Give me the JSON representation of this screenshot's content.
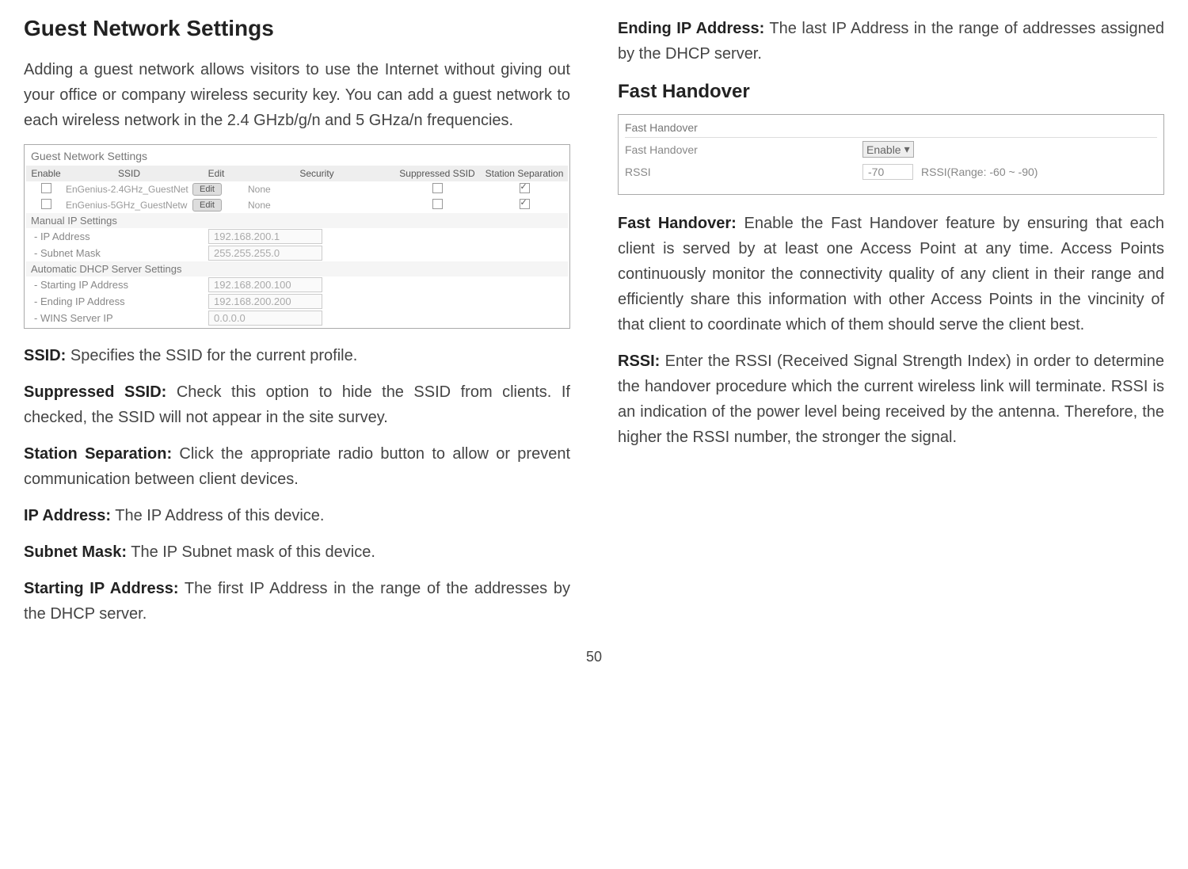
{
  "left": {
    "h2": "Guest Network Settings",
    "intro": "Adding a guest network allows visitors to use the Internet without giving out your office or company wireless security key. You can add a guest network to each wireless network in the  2.4 GHzb/g/n and 5 GHza/n frequencies.",
    "table": {
      "title": "Guest Network Settings",
      "headers": {
        "enable": "Enable",
        "ssid": "SSID",
        "edit": "Edit",
        "security": "Security",
        "suppressed": "Suppressed SSID",
        "station": "Station Separation"
      },
      "rows": [
        {
          "ssid": "EnGenius-2.4GHz_GuestNet",
          "edit": "Edit",
          "security": "None"
        },
        {
          "ssid": "EnGenius-5GHz_GuestNetw",
          "edit": "Edit",
          "security": "None"
        }
      ],
      "manual_label": "Manual IP Settings",
      "ip_address": {
        "lbl": "- IP Address",
        "val": "192.168.200.1"
      },
      "subnet": {
        "lbl": "- Subnet Mask",
        "val": "255.255.255.0"
      },
      "dhcp_label": "Automatic DHCP Server Settings",
      "start_ip": {
        "lbl": "- Starting IP Address",
        "val": "192.168.200.100"
      },
      "end_ip": {
        "lbl": "- Ending IP Address",
        "val": "192.168.200.200"
      },
      "wins": {
        "lbl": "- WINS Server IP",
        "val": "0.0.0.0"
      }
    },
    "ssid_label": "SSID:",
    "ssid_text": " Specifies the SSID for the current profile.",
    "supp_label": "Suppressed SSID:",
    "supp_text": " Check this option to hide the SSID from clients. If checked, the SSID will not appear in the site survey.",
    "station_label": "Station Separation:",
    "station_text": " Click the appropriate radio button to allow or prevent communication between client devices.",
    "ipaddr_label": "IP Address:",
    "ipaddr_text": " The IP Address of this device.",
    "subnet_label": "Subnet Mask:",
    "subnet_text": " The IP Subnet mask of this device.",
    "startip_label": "Starting IP Address:",
    "startip_text": " The first IP Address in the range of the addresses by the DHCP server."
  },
  "right": {
    "endip_label": "Ending IP Address:",
    "endip_text": " The last IP Address in the range of addresses assigned by the DHCP server.",
    "h3": "Fast Handover",
    "fh_table": {
      "title": "Fast Handover",
      "row1_lbl": "Fast Handover",
      "row1_val": "Enable",
      "row2_lbl": "RSSI",
      "row2_val": "-70",
      "row2_hint": "RSSI(Range: -60 ~ -90)"
    },
    "fh_label": "Fast Handover:",
    "fh_text": " Enable the Fast Handover feature by ensuring that each client is served by at least one Access Point at any time. Access Points continuously monitor the connectivity quality of any client in their range and efficiently share this information with other Access Points in the vincinity of that client to coordinate which of them should serve the client best.",
    "rssi_label": "RSSI:",
    "rssi_text": " Enter the RSSI (Received Signal Strength Index) in order to determine the handover procedure which the current wireless link will terminate. RSSI is an indication of the power level being received by the antenna. Therefore, the higher the RSSI number, the stronger the signal."
  },
  "page_num": "50"
}
